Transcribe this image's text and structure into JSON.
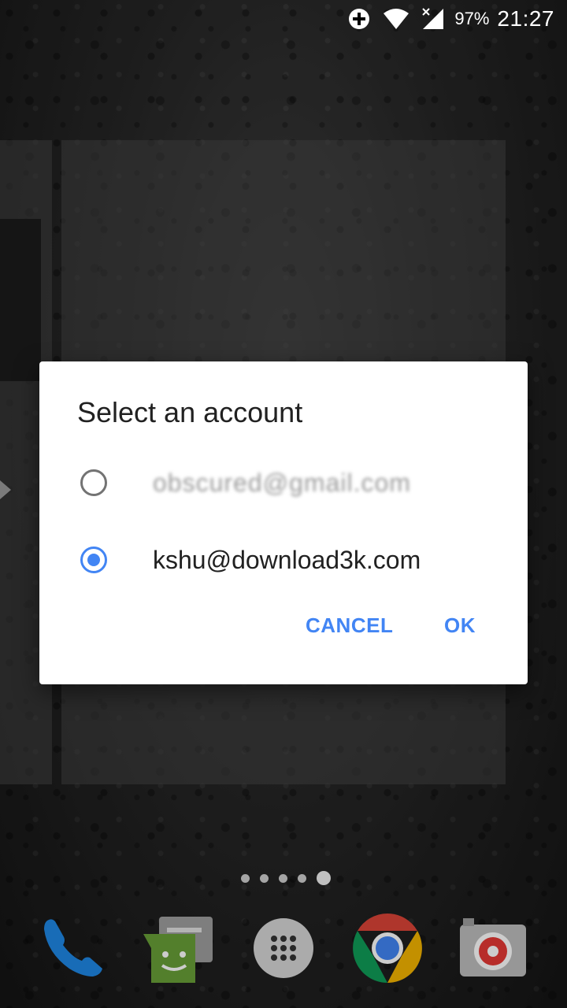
{
  "status_bar": {
    "battery_percent": "97%",
    "time": "21:27",
    "icons": [
      "data-saver-icon",
      "wifi-icon",
      "cellular-no-signal-icon",
      "battery-icon"
    ]
  },
  "dialog": {
    "title": "Select an account",
    "options": [
      {
        "label": "obscured@gmail.com",
        "selected": false
      },
      {
        "label": "kshu@download3k.com",
        "selected": true
      }
    ],
    "cancel_label": "CANCEL",
    "ok_label": "OK"
  },
  "home": {
    "page_count": 5,
    "active_page": 5,
    "dock_apps": [
      "phone-icon",
      "messenger-icon",
      "app-drawer-icon",
      "chrome-icon",
      "camera-icon"
    ]
  },
  "colors": {
    "accent": "#4285f4",
    "dialog_bg": "#ffffff",
    "title_text": "#212121"
  }
}
